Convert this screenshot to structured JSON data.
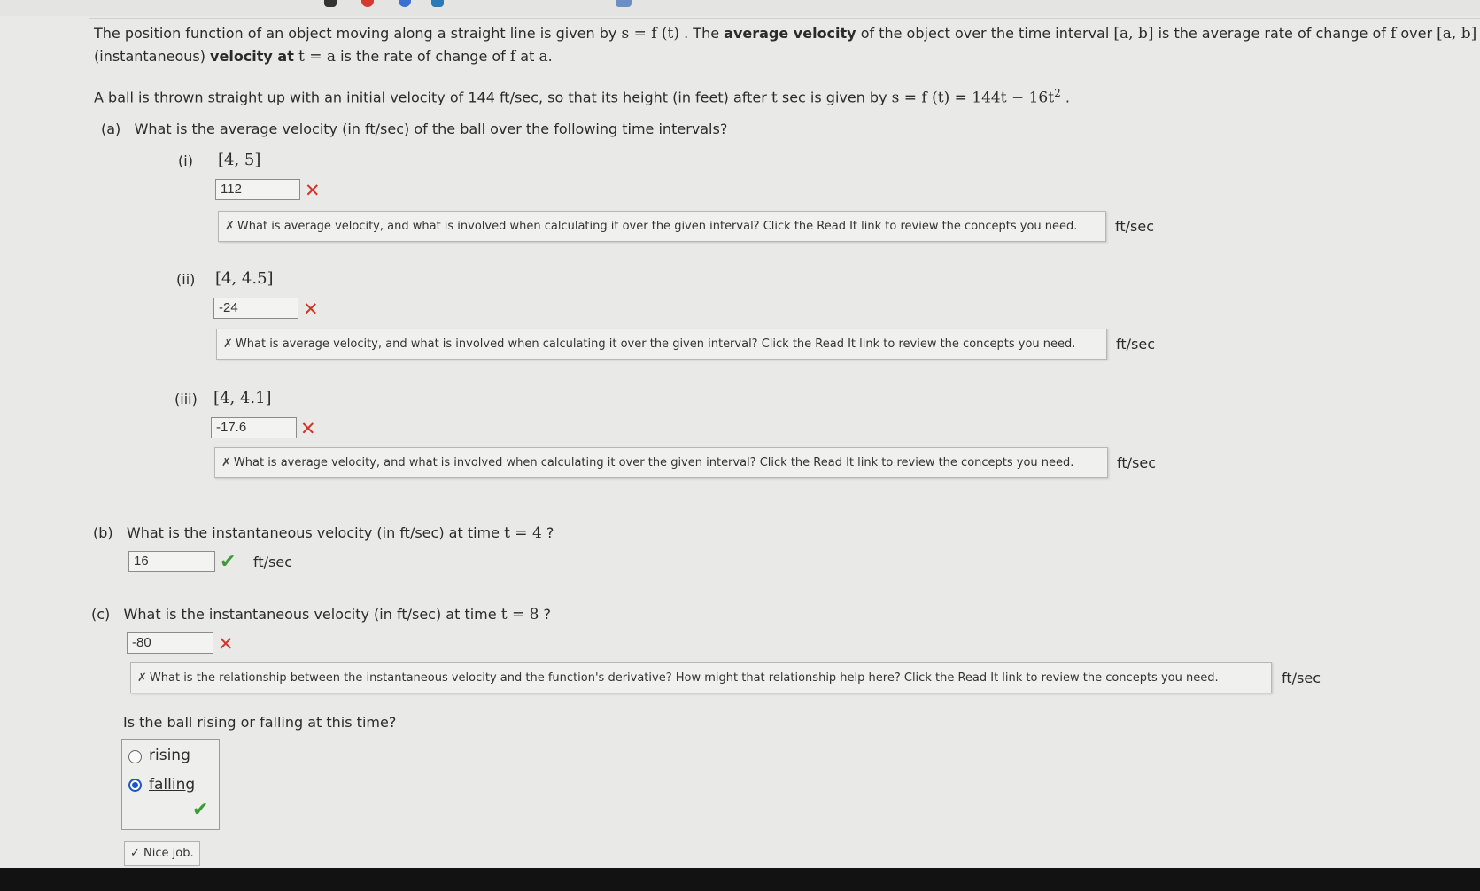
{
  "intro": {
    "line1_part1": "The position function of an object moving along a straight line is given by",
    "line1_math1": "s = f (t)",
    "line1_part2": ". The",
    "line1_bold1": "average velocity",
    "line1_part3": "of the object over the time interval",
    "line1_math2": "[a, b]",
    "line1_part4": "is the average rate of change of",
    "line1_math3": "f",
    "line1_part5": "over",
    "line1_math4": "[a, b]",
    "line2_part1": "(instantaneous)",
    "line2_bold1": "velocity at",
    "line2_math1": "t = a",
    "line2_part2": "is the rate of change of",
    "line2_math2": "f",
    "line2_part3": "at",
    "line2_math3": "a",
    "line2_end": "."
  },
  "problem": {
    "text": "A ball is thrown straight up with an initial velocity of 144 ft/sec, so that its height (in feet) after",
    "math_t": "t",
    "text2": "sec is given by",
    "equation": "s = f (t) = 144t − 16t",
    "exponent": "2",
    "end": "."
  },
  "part_a": {
    "label": "(a)",
    "question": "What is the average velocity (in ft/sec) of the ball over the following time intervals?",
    "items": [
      {
        "label": "(i)",
        "interval": "[4, 5]",
        "answer": "112",
        "status": "incorrect",
        "feedback": "What is average velocity, and what is involved when calculating it over the given interval? Click the Read It link to review the concepts you need.",
        "unit": "ft/sec"
      },
      {
        "label": "(ii)",
        "interval": "[4, 4.5]",
        "answer": "-24",
        "status": "incorrect",
        "feedback": "What is average velocity, and what is involved when calculating it over the given interval? Click the Read It link to review the concepts you need.",
        "unit": "ft/sec"
      },
      {
        "label": "(iii)",
        "interval": "[4, 4.1]",
        "answer": "-17.6",
        "status": "incorrect",
        "feedback": "What is average velocity, and what is involved when calculating it over the given interval? Click the Read It link to review the concepts you need.",
        "unit": "ft/sec"
      }
    ]
  },
  "part_b": {
    "label": "(b)",
    "question": "What is the instantaneous velocity (in ft/sec) at time",
    "math": "t = 4",
    "qmark": "?",
    "answer": "16",
    "status": "correct",
    "unit": "ft/sec"
  },
  "part_c": {
    "label": "(c)",
    "question": "What is the instantaneous velocity (in ft/sec) at time",
    "math": "t = 8",
    "qmark": "?",
    "answer": "-80",
    "status": "incorrect",
    "feedback": "What is the relationship between the instantaneous velocity and the function's derivative? How might that relationship help here? Click the Read It link to review the concepts you need.",
    "unit": "ft/sec",
    "followup": "Is the ball rising or falling at this time?",
    "options": [
      "rising",
      "falling"
    ],
    "selected": "falling",
    "followup_status": "correct",
    "nice_job": "Nice job."
  },
  "icons": {
    "incorrect": "x-mark-icon",
    "correct": "check-mark-icon",
    "feedback": "feedback-x-icon"
  },
  "colors": {
    "incorrect": "#d1342a",
    "correct": "#3d9a36",
    "radio_selected": "#1a55c9"
  }
}
